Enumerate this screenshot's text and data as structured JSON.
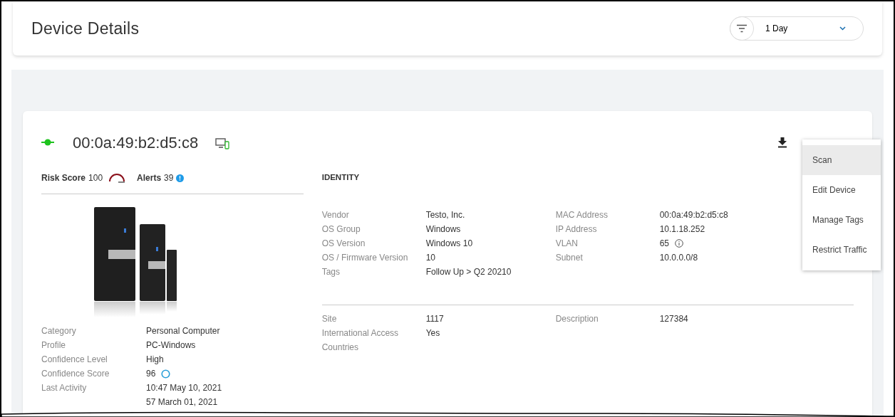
{
  "page_title": "Device Details",
  "time_filter": {
    "value": "1 Day"
  },
  "device": {
    "connected": true,
    "mac": "00:0a:49:b2:d5:c8",
    "risk_label": "Risk Score",
    "risk_value": "100",
    "alerts_label": "Alerts",
    "alerts_value": "39",
    "summary": [
      {
        "label": "Category",
        "value": "Personal Computer"
      },
      {
        "label": "Profile",
        "value": "PC-Windows"
      },
      {
        "label": "Confidence Level",
        "value": "High"
      },
      {
        "label": "Confidence Score",
        "value": "96",
        "kind": "score"
      },
      {
        "label": "Last Activity",
        "value": "10:47 May 10, 2021"
      }
    ],
    "cut_row_value": "57 March 01, 2021"
  },
  "identity": {
    "title": "IDENTITY",
    "left": [
      {
        "label": "Vendor",
        "value": "Testo, Inc."
      },
      {
        "label": "OS Group",
        "value": "Windows"
      },
      {
        "label": "OS Version",
        "value": "Windows 10"
      },
      {
        "label": "OS / Firmware Version",
        "value": "10"
      },
      {
        "label": "Tags",
        "value": "Follow Up > Q2 20210"
      }
    ],
    "right": [
      {
        "label": "MAC Address",
        "value": "00:0a:49:b2:d5:c8"
      },
      {
        "label": "IP Address",
        "value": "10.1.18.252"
      },
      {
        "label": "VLAN",
        "value": "65",
        "kind": "info"
      },
      {
        "label": "Subnet",
        "value": "10.0.0.0/8"
      }
    ],
    "lower_left": [
      {
        "label": "Site",
        "value": "1117"
      },
      {
        "label": "International Access",
        "value": "Yes"
      },
      {
        "label": "Countries"
      }
    ],
    "lower_right": [
      {
        "label": "Description",
        "value": "127384"
      }
    ]
  },
  "menu": [
    {
      "label": "Scan",
      "selected": true
    },
    {
      "label": "Edit Device",
      "selected": false
    },
    {
      "label": "Manage Tags",
      "selected": false
    },
    {
      "label": "Restrict Traffic",
      "selected": false
    }
  ]
}
